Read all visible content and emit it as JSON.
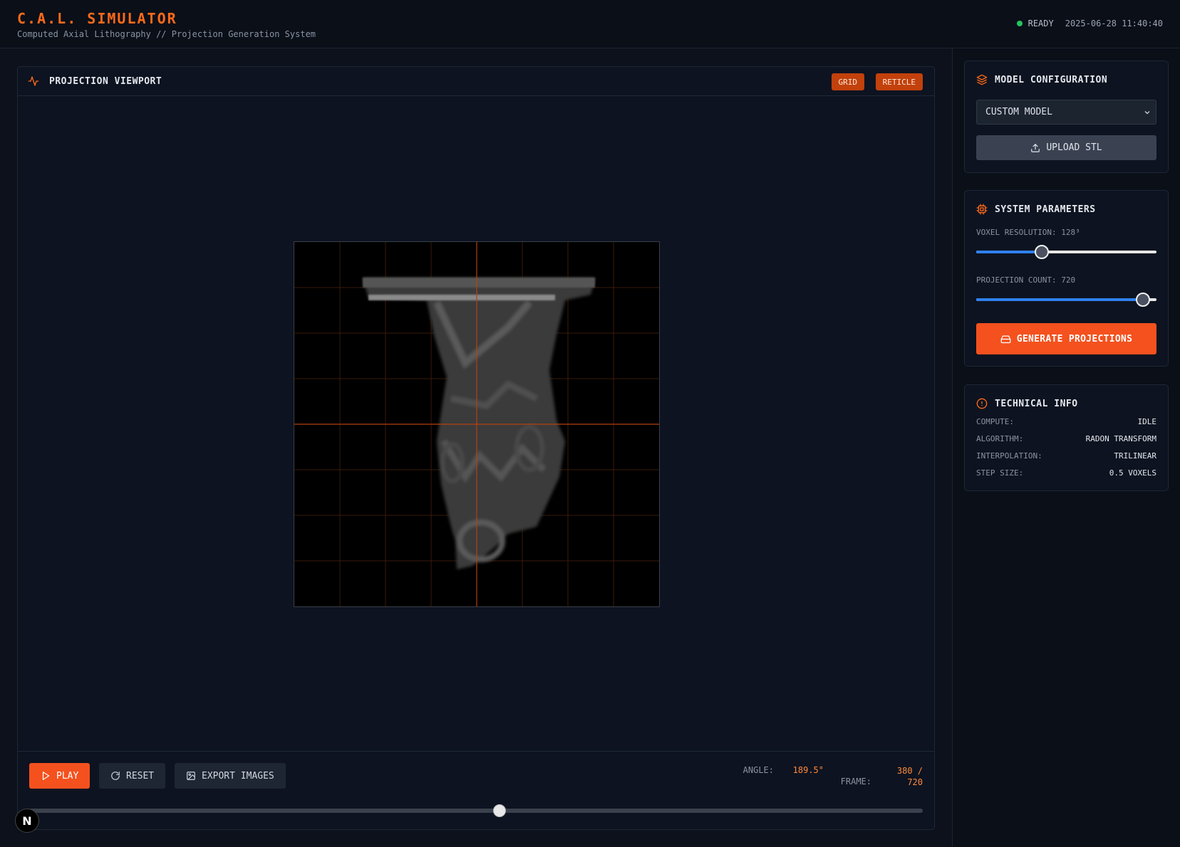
{
  "header": {
    "title": "C.A.L. SIMULATOR",
    "subtitle": "Computed Axial Lithography // Projection Generation System",
    "status": "READY",
    "timestamp": "2025-06-28 11:40:40",
    "status_color": "#22c55e"
  },
  "viewport": {
    "title": "PROJECTION VIEWPORT",
    "toggles": {
      "grid": "GRID",
      "reticle": "RETICLE"
    },
    "playback": {
      "play_label": "PLAY",
      "reset_label": "RESET",
      "export_label": "EXPORT IMAGES",
      "angle_label": "ANGLE:",
      "angle_value": "189.5°",
      "frame_label": "FRAME:",
      "frame_value": "380 /",
      "frame_total": "720",
      "timeline_progress": 0.527
    }
  },
  "sidebar": {
    "model": {
      "title": "MODEL CONFIGURATION",
      "selected": "CUSTOM MODEL",
      "upload_label": "UPLOAD STL"
    },
    "system": {
      "title": "SYSTEM PARAMETERS",
      "voxel_label": "VOXEL RESOLUTION: 128³",
      "voxel_progress": 0.35,
      "projection_label": "PROJECTION COUNT: 720",
      "projection_progress": 0.96,
      "generate_label": "GENERATE PROJECTIONS"
    },
    "tech": {
      "title": "TECHNICAL INFO",
      "rows": [
        {
          "key": "COMPUTE:",
          "value": "IDLE"
        },
        {
          "key": "ALGORITHM:",
          "value": "RADON TRANSFORM"
        },
        {
          "key": "INTERPOLATION:",
          "value": "TRILINEAR"
        },
        {
          "key": "STEP SIZE:",
          "value": "0.5 VOXELS"
        }
      ]
    }
  },
  "colors": {
    "accent": "#f4511e",
    "accent_text": "#ff8a3d",
    "slider_fill": "#2f80ed",
    "background": "#0c111b"
  },
  "icons": {
    "viewport": "activity-icon",
    "model": "layers-icon",
    "system": "chip-icon",
    "tech": "alert-circle-icon",
    "upload": "upload-icon",
    "generate": "drive-icon",
    "play": "play-icon",
    "reset": "refresh-icon",
    "export": "image-icon"
  }
}
